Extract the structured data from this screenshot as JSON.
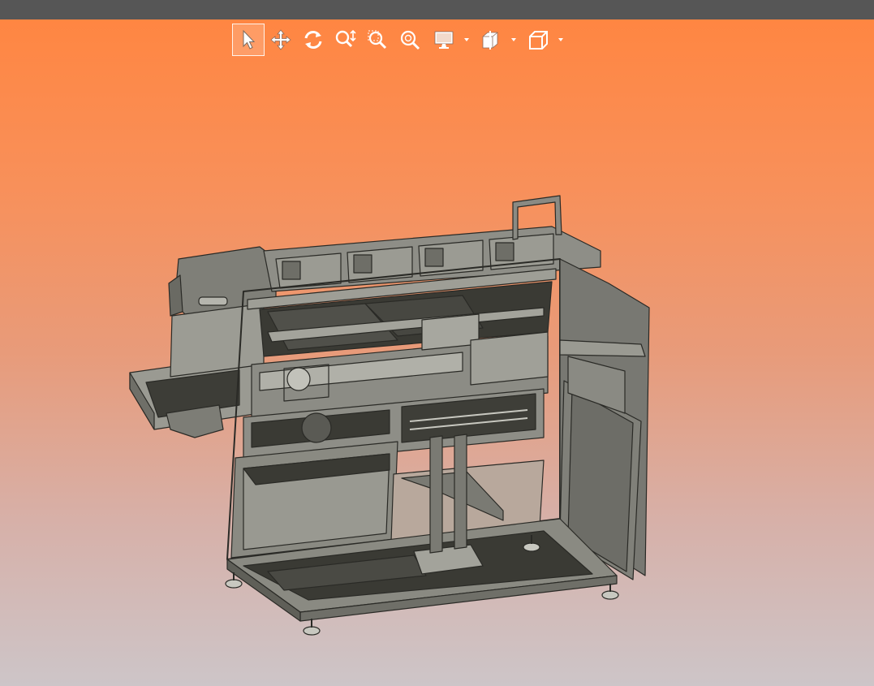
{
  "window": {
    "titlebar_color": "#565656"
  },
  "viewport": {
    "background_top": "#ff8642",
    "background_bottom": "#cdc5c8"
  },
  "toolbar": {
    "buttons": [
      {
        "name": "select",
        "icon": "arrow-pointer-icon",
        "active": true
      },
      {
        "name": "pan",
        "icon": "move-arrows-icon",
        "active": false
      },
      {
        "name": "rotate",
        "icon": "rotate-icon",
        "active": false
      },
      {
        "name": "zoom",
        "icon": "zoom-icon",
        "active": false
      },
      {
        "name": "zoom-window",
        "icon": "zoom-window-icon",
        "active": false
      },
      {
        "name": "zoom-fit",
        "icon": "zoom-fit-icon",
        "active": false
      },
      {
        "name": "display-mode",
        "icon": "monitor-icon",
        "has_dropdown": true
      },
      {
        "name": "section-view",
        "icon": "section-cube-icon",
        "has_dropdown": true
      },
      {
        "name": "standard-views",
        "icon": "cube-icon",
        "has_dropdown": true
      }
    ]
  },
  "model": {
    "icon": "cad-assembly-machine",
    "body_color": "#8f8f88",
    "dark_color": "#3a3a34"
  }
}
